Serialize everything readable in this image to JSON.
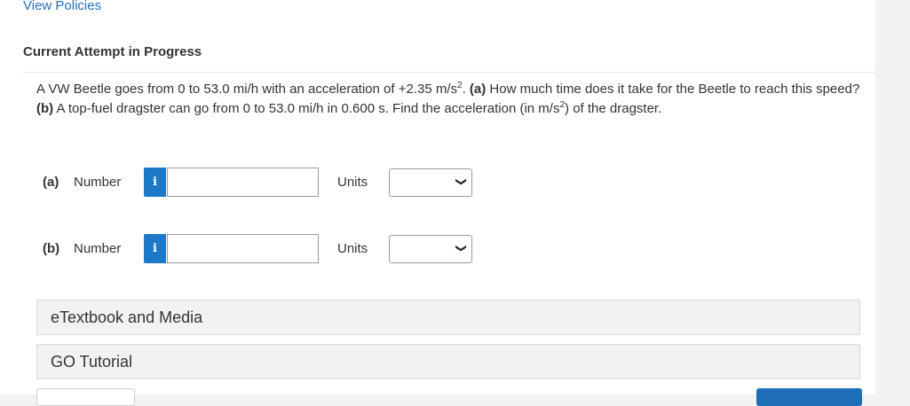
{
  "links": {
    "view_policies": "View Policies"
  },
  "attempt": {
    "heading": "Current Attempt in Progress"
  },
  "question": {
    "text_1": "A VW Beetle goes from 0 to 53.0 mi/h with an acceleration of +2.35 m/s",
    "sup_1": "2",
    "text_2": ". ",
    "part_a_marker": "(a)",
    "text_3": " How much time does it take for the Beetle to reach this speed? ",
    "part_b_marker": "(b)",
    "text_4": " A top-fuel dragster can go from 0 to 53.0 mi/h in 0.600 s. Find the acceleration (in m/s",
    "sup_2": "2",
    "text_5": ") of the dragster."
  },
  "answers": [
    {
      "part_label": "(a)",
      "number_label": "Number",
      "info_icon": "info-icon",
      "info_glyph": "i",
      "number_value": "",
      "units_label": "Units",
      "units_selected": ""
    },
    {
      "part_label": "(b)",
      "number_label": "Number",
      "info_icon": "info-icon",
      "info_glyph": "i",
      "number_value": "",
      "units_label": "Units",
      "units_selected": ""
    }
  ],
  "panels": {
    "etextbook": "eTextbook and Media",
    "go_tutorial": "GO Tutorial"
  },
  "colors": {
    "link": "#2a6ebb",
    "info_button": "#1e78c8",
    "primary_button": "#1e6fb8",
    "panel_bg": "#f2f2f2"
  }
}
